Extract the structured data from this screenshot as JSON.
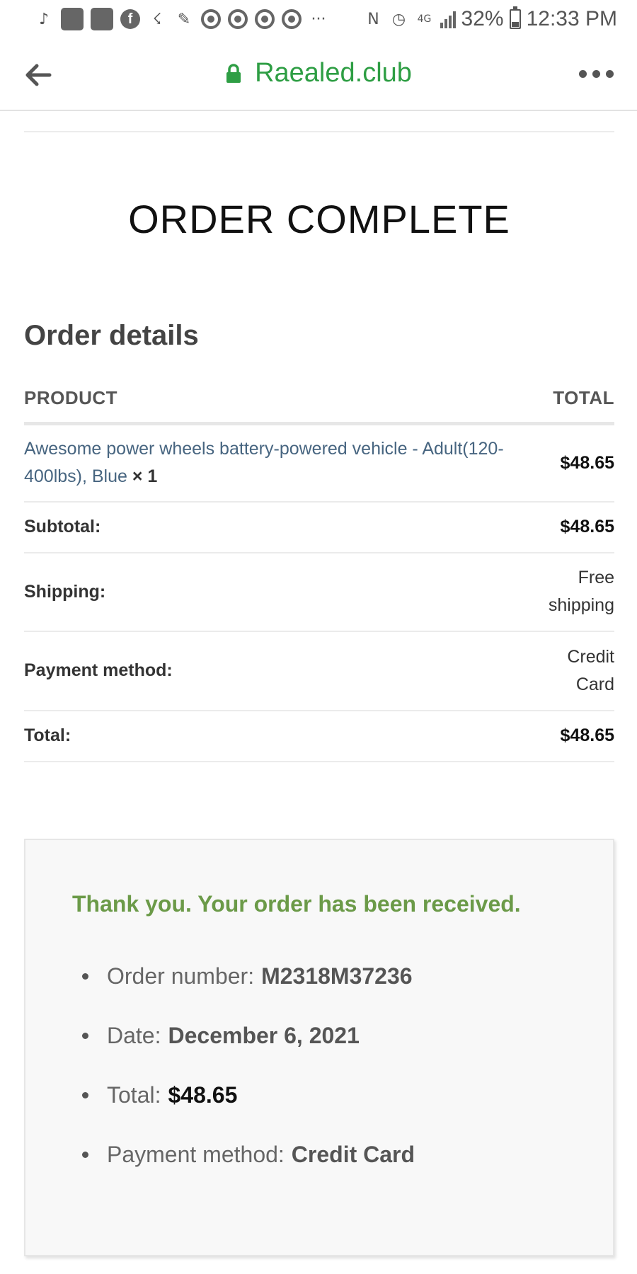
{
  "status_bar": {
    "battery": "32%",
    "time": "12:33 PM",
    "icons": [
      "tiktok-icon",
      "app-icon",
      "app-icon",
      "facebook-icon",
      "missed-call-icon",
      "muted-icon",
      "chrome-icon",
      "chrome-icon",
      "chrome-icon",
      "chrome-icon",
      "more-icon",
      "nfc-icon",
      "alarm-icon",
      "4g-lte-icon",
      "signal-icon",
      "battery-icon"
    ]
  },
  "url_bar": {
    "domain": "Raealed.club",
    "accent": "#2e9e44"
  },
  "page": {
    "title": "ORDER COMPLETE",
    "section_title": "Order details"
  },
  "table": {
    "headers": {
      "product": "PRODUCT",
      "total": "TOTAL"
    },
    "product": {
      "name": "Awesome power wheels battery-powered vehicle - Adult(120-400lbs), Blue",
      "qty": "× 1",
      "price": "$48.65"
    },
    "rows": {
      "subtotal": {
        "label": "Subtotal:",
        "value": "$48.65"
      },
      "shipping": {
        "label": "Shipping:",
        "value_line1": "Free",
        "value_line2": "shipping"
      },
      "payment": {
        "label": "Payment method:",
        "value_line1": "Credit",
        "value_line2": "Card"
      },
      "total": {
        "label": "Total:",
        "value": "$48.65"
      }
    }
  },
  "confirmation": {
    "message": "Thank you. Your order has been received.",
    "message_color": "#6b9a48",
    "details": {
      "order_number_label": "Order number:",
      "order_number": "M2318M37236",
      "date_label": "Date:",
      "date": "December 6, 2021",
      "total_label": "Total:",
      "total": "$48.65",
      "payment_label": "Payment method:",
      "payment": "Credit Card"
    }
  }
}
